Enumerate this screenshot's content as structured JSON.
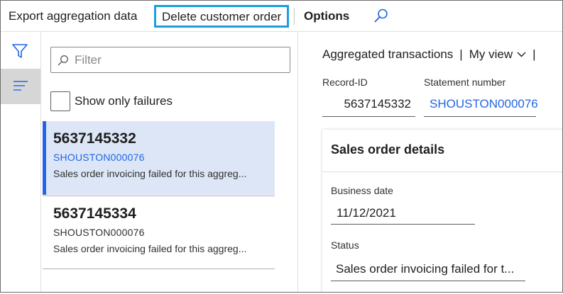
{
  "toolbar": {
    "export_label": "Export aggregation data",
    "delete_label": "Delete customer order",
    "options_label": "Options",
    "search_icon": "search-icon"
  },
  "rail": {
    "filter_icon": "filter-icon",
    "list_icon": "list-view-icon"
  },
  "list": {
    "filter_placeholder": "Filter",
    "show_failures_label": "Show only failures",
    "items": [
      {
        "record_id": "5637145332",
        "statement": "SHOUSTON000076",
        "message": "Sales order invoicing failed for this aggreg...",
        "selected": true
      },
      {
        "record_id": "5637145334",
        "statement": "SHOUSTON000076",
        "message": "Sales order invoicing failed for this aggreg...",
        "selected": false
      }
    ]
  },
  "detail": {
    "breadcrumb_title": "Aggregated transactions",
    "breadcrumb_sep": "|",
    "view_label": "My view",
    "record_id_label": "Record-ID",
    "record_id_value": "5637145332",
    "statement_label": "Statement number",
    "statement_value": "SHOUSTON000076",
    "section_title": "Sales order details",
    "business_date_label": "Business date",
    "business_date_value": "11/12/2021",
    "status_label": "Status",
    "status_value": "Sales order invoicing failed for t..."
  },
  "colors": {
    "accent": "#2266e3",
    "highlight_border": "#1a9ee0",
    "selected_bg": "#dce6f7"
  }
}
